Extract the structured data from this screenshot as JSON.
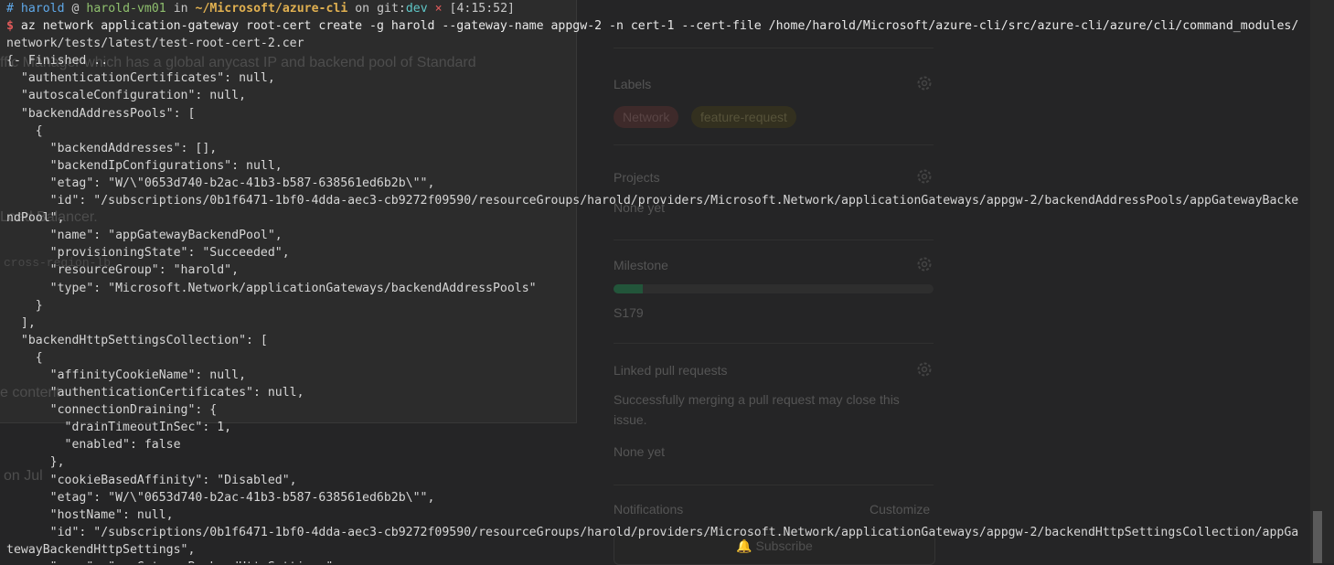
{
  "background_page": {
    "left_fragments": [
      "ffic Manager which has a global anycast IP and backend pool of Standard",
      "Load Balancer.",
      "cross-region-lb",
      "e content",
      "on Jul"
    ],
    "sidebar": {
      "labels_title": "Labels",
      "labels": [
        {
          "text": "Network",
          "color": "#3e2a2a"
        },
        {
          "text": "feature-request",
          "color": "#33301f"
        }
      ],
      "projects_title": "Projects",
      "projects_value": "None yet",
      "milestone_title": "Milestone",
      "milestone_value": "S179",
      "milestone_progress": 0.09,
      "linked_title": "Linked pull requests",
      "linked_desc_1": "Successfully merging a pull request may close this",
      "linked_desc_2": "issue.",
      "linked_value": "None yet",
      "notifications_title": "Notifications",
      "customize_label": "Customize",
      "subscribe_label": "Subscribe"
    }
  },
  "terminal": {
    "prompt": {
      "hash": "#",
      "user": "harold",
      "at": "@",
      "host": "harold-vm01",
      "in": "in",
      "path": "~/Microsoft/azure-cli",
      "on": "on",
      "git": "git:",
      "branch": "dev",
      "dirty": "×",
      "time": "[4:15:52]",
      "dollar": "$"
    },
    "command": "az network application-gateway root-cert create -g harold --gateway-name appgw-2 -n cert-1 --cert-file /home/harold/Microsoft/azure-cli/src/azure-cli/azure/cli/command_modules/",
    "command_wrap": "network/tests/latest/test-root-cert-2.cer",
    "output": [
      "{- Finished ..",
      "  \"authenticationCertificates\": null,",
      "  \"autoscaleConfiguration\": null,",
      "  \"backendAddressPools\": [",
      "    {",
      "      \"backendAddresses\": [],",
      "      \"backendIpConfigurations\": null,",
      "      \"etag\": \"W/\\\"0653d740-b2ac-41b3-b587-638561ed6b2b\\\"\",",
      "      \"id\": \"/subscriptions/0b1f6471-1bf0-4dda-aec3-cb9272f09590/resourceGroups/harold/providers/Microsoft.Network/applicationGateways/appgw-2/backendAddressPools/appGatewayBacke",
      "ndPool\",",
      "      \"name\": \"appGatewayBackendPool\",",
      "      \"provisioningState\": \"Succeeded\",",
      "      \"resourceGroup\": \"harold\",",
      "      \"type\": \"Microsoft.Network/applicationGateways/backendAddressPools\"",
      "    }",
      "  ],",
      "  \"backendHttpSettingsCollection\": [",
      "    {",
      "      \"affinityCookieName\": null,",
      "      \"authenticationCertificates\": null,",
      "      \"connectionDraining\": {",
      "        \"drainTimeoutInSec\": 1,",
      "        \"enabled\": false",
      "      },",
      "      \"cookieBasedAffinity\": \"Disabled\",",
      "      \"etag\": \"W/\\\"0653d740-b2ac-41b3-b587-638561ed6b2b\\\"\",",
      "      \"hostName\": null,",
      "      \"id\": \"/subscriptions/0b1f6471-1bf0-4dda-aec3-cb9272f09590/resourceGroups/harold/providers/Microsoft.Network/applicationGateways/appgw-2/backendHttpSettingsCollection/appGa",
      "tewayBackendHttpSettings\",",
      "      \"name\": \"appGatewayBackendHttpSettings\","
    ]
  }
}
